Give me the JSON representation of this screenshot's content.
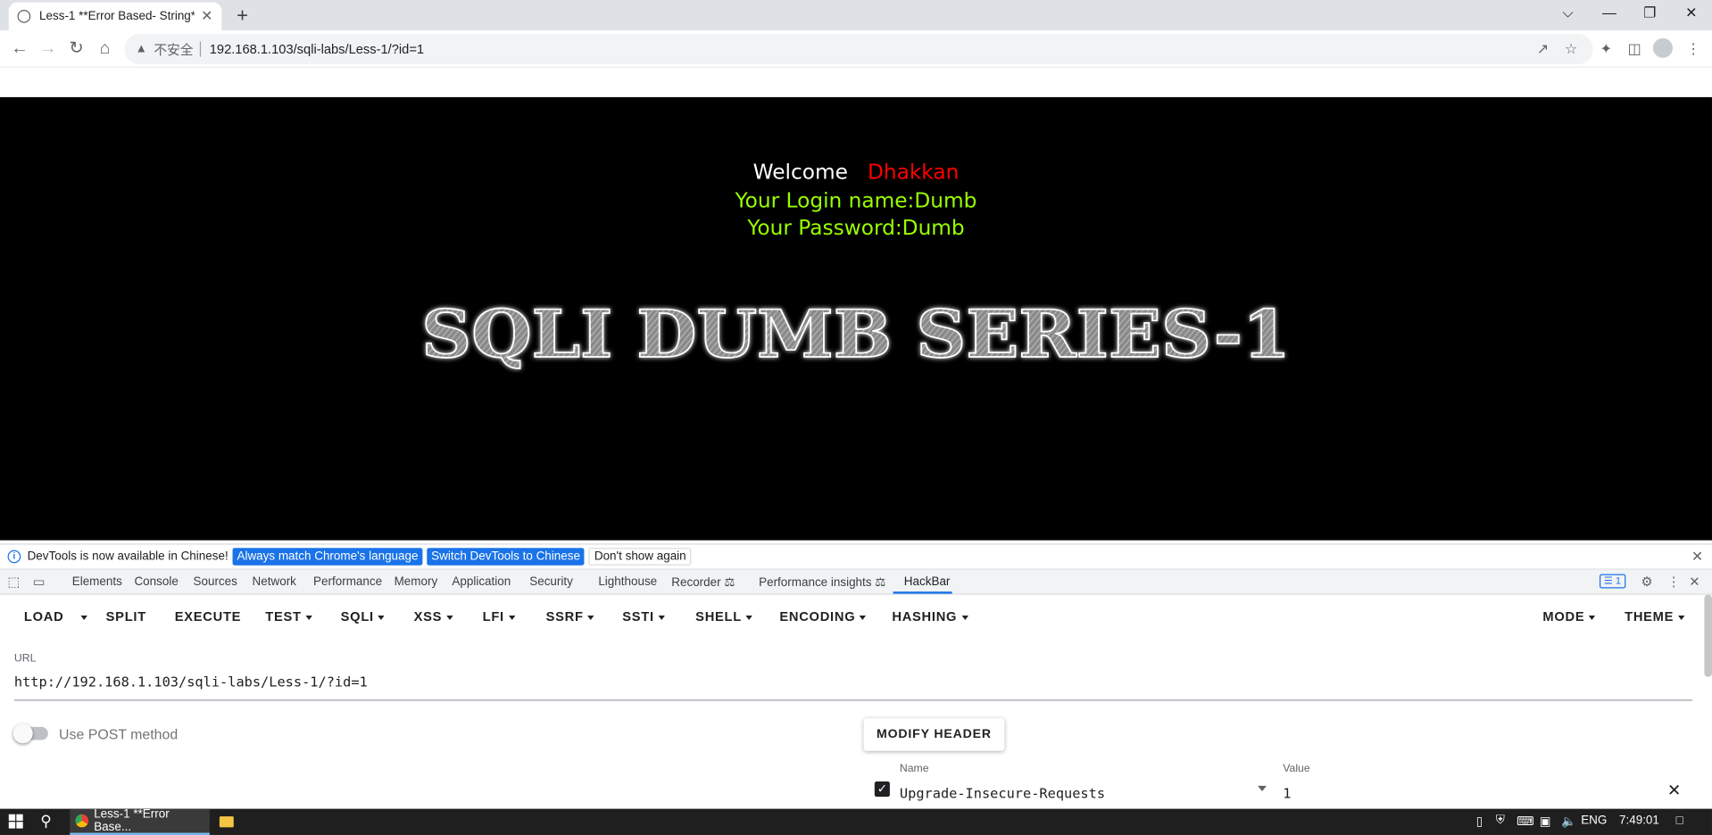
{
  "browser": {
    "tab_title": "Less-1 **Error Based- String**",
    "tab_close": "✕",
    "new_tab": "+",
    "window_controls": [
      "⌵",
      "—",
      "❐",
      "✕"
    ],
    "security_label": "不安全",
    "url": "192.168.1.103/sqli-labs/Less-1/?id=1",
    "icons": [
      "back-icon",
      "forward-icon",
      "reload-icon",
      "home-icon",
      "share-icon",
      "bookmark-star-icon",
      "extensions-icon",
      "side-panel-icon",
      "profile-icon",
      "menu-icon"
    ]
  },
  "page": {
    "welcome": "Welcome",
    "user": "Dhakkan",
    "login_line": "Your Login name:Dumb",
    "password_line": "Your Password:Dumb",
    "banner": "SQLI DUMB SERIES-1",
    "colors": {
      "background": "#000000",
      "welcome": "#ffffff",
      "user": "#ff0000",
      "credentials": "#99ff00"
    }
  },
  "devtools": {
    "infobar": {
      "message": "DevTools is now available in Chinese!",
      "match_button": "Always match Chrome's language",
      "switch_button": "Switch DevTools to Chinese",
      "dismiss_button": "Don't show again"
    },
    "tabs": [
      "Elements",
      "Console",
      "Sources",
      "Network",
      "Performance",
      "Memory",
      "Application",
      "Security",
      "Lighthouse",
      "Recorder",
      "Performance insights",
      "HackBar"
    ],
    "active_tab": "HackBar",
    "issues_count": "1"
  },
  "hackbar": {
    "menu": {
      "load": "LOAD",
      "split": "SPLIT",
      "execute": "EXECUTE",
      "test": "TEST",
      "sqli": "SQLI",
      "xss": "XSS",
      "lfi": "LFI",
      "ssrf": "SSRF",
      "ssti": "SSTI",
      "shell": "SHELL",
      "encoding": "ENCODING",
      "hashing": "HASHING",
      "mode": "MODE",
      "theme": "THEME"
    },
    "url_label": "URL",
    "url_value": "http://192.168.1.103/sqli-labs/Less-1/?id=1",
    "post_label": "Use POST method",
    "post_enabled": false,
    "modify_header": "MODIFY HEADER",
    "headers_table": {
      "name_label": "Name",
      "value_label": "Value",
      "rows": [
        {
          "enabled": true,
          "name": "Upgrade-Insecure-Requests",
          "value": "1"
        }
      ]
    },
    "accent": "#1a73e8"
  },
  "taskbar": {
    "task_label": "Less-1 **Error Base...",
    "language": "ENG",
    "time": "7:49:01"
  }
}
